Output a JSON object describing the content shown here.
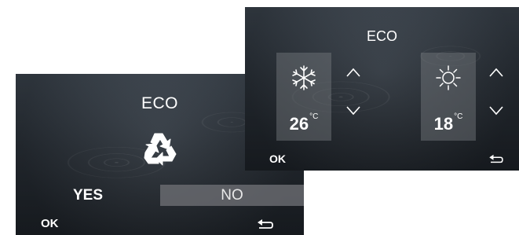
{
  "confirm_screen": {
    "title": "ECO",
    "yes_label": "YES",
    "no_label": "NO",
    "ok_label": "OK",
    "icon": "recycle-icon",
    "back_icon": "return-icon"
  },
  "settings_screen": {
    "title": "ECO",
    "cooling": {
      "icon": "snowflake-icon",
      "temperature": "26",
      "unit": "°C"
    },
    "heating": {
      "icon": "sun-icon",
      "temperature": "18",
      "unit": "°C"
    },
    "ok_label": "OK",
    "back_icon": "return-icon"
  },
  "colors": {
    "text": "#ffffff",
    "no_button_bg": "#6e7074",
    "panel_bg": "#787c80"
  }
}
